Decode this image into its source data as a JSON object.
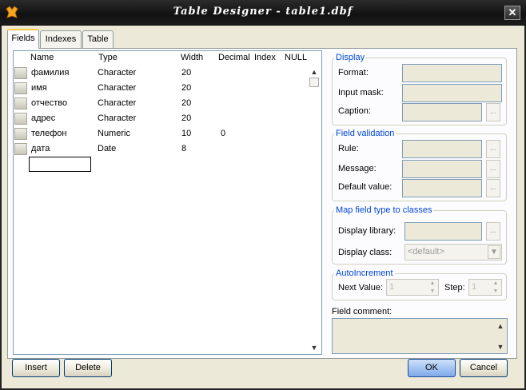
{
  "window": {
    "title": "Table Designer - table1.dbf",
    "close_glyph": "✕"
  },
  "tabs": [
    {
      "label": "Fields"
    },
    {
      "label": "Indexes"
    },
    {
      "label": "Table"
    }
  ],
  "grid": {
    "columns": [
      "Name",
      "Type",
      "Width",
      "Decimal",
      "Index",
      "NULL"
    ],
    "rows": [
      {
        "name": "фамилия",
        "type": "Character",
        "width": "20",
        "decimal": ""
      },
      {
        "name": "имя",
        "type": "Character",
        "width": "20",
        "decimal": ""
      },
      {
        "name": "отчество",
        "type": "Character",
        "width": "20",
        "decimal": ""
      },
      {
        "name": "адрес",
        "type": "Character",
        "width": "20",
        "decimal": ""
      },
      {
        "name": "телефон",
        "type": "Numeric",
        "width": "10",
        "decimal": "0"
      },
      {
        "name": "дата",
        "type": "Date",
        "width": "8",
        "decimal": ""
      }
    ]
  },
  "display": {
    "title": "Display",
    "format_label": "Format:",
    "input_mask_label": "Input mask:",
    "caption_label": "Caption:"
  },
  "validation": {
    "title": "Field validation",
    "rule_label": "Rule:",
    "message_label": "Message:",
    "default_label": "Default value:"
  },
  "mapping": {
    "title": "Map field type to classes",
    "library_label": "Display library:",
    "class_label": "Display class:",
    "class_value": "<default>"
  },
  "autoinc": {
    "title": "AutoIncrement",
    "next_label": "Next Value:",
    "next_value": "1",
    "step_label": "Step:",
    "step_value": "1"
  },
  "comment": {
    "label": "Field comment:"
  },
  "buttons": {
    "insert": "Insert",
    "delete": "Delete",
    "ok": "OK",
    "cancel": "Cancel",
    "ellipsis": "..."
  },
  "icons": {
    "app": "fox-logo-icon",
    "close": "close-icon",
    "up": "▲",
    "down": "▼",
    "combo": "▼"
  },
  "colors": {
    "accent": "#0046d5",
    "tab_highlight": "#ffc83c",
    "titlebar": "#1c1c1c"
  }
}
